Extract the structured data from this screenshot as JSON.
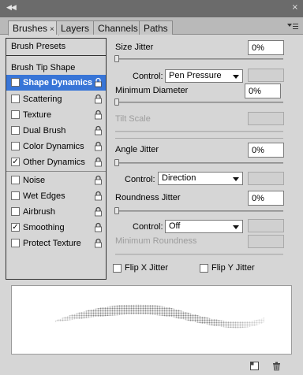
{
  "window": {
    "collapse_glyph": "◀◀",
    "close_glyph": "×"
  },
  "tabs": [
    {
      "label": "Brushes",
      "close": "×",
      "active": true
    },
    {
      "label": "Layers",
      "active": false
    },
    {
      "label": "Channels",
      "active": false
    },
    {
      "label": "Paths",
      "active": false
    }
  ],
  "left": {
    "presets_label": "Brush Presets",
    "tip_label": "Brush Tip Shape",
    "options": [
      {
        "label": "Shape Dynamics",
        "checked": true,
        "selected": true
      },
      {
        "label": "Scattering",
        "checked": false
      },
      {
        "label": "Texture",
        "checked": false
      },
      {
        "label": "Dual Brush",
        "checked": false
      },
      {
        "label": "Color Dynamics",
        "checked": false
      },
      {
        "label": "Other Dynamics",
        "checked": true
      },
      {
        "label": "Noise",
        "checked": false
      },
      {
        "label": "Wet Edges",
        "checked": false
      },
      {
        "label": "Airbrush",
        "checked": false
      },
      {
        "label": "Smoothing",
        "checked": true
      },
      {
        "label": "Protect Texture",
        "checked": false
      }
    ]
  },
  "right": {
    "size_jitter": {
      "label": "Size Jitter",
      "value": "0%"
    },
    "size_control": {
      "label": "Control:",
      "value": "Pen Pressure"
    },
    "min_diameter": {
      "label": "Minimum Diameter",
      "value": "0%"
    },
    "tilt_scale": {
      "label": "Tilt Scale"
    },
    "angle_jitter": {
      "label": "Angle Jitter",
      "value": "0%"
    },
    "angle_control": {
      "label": "Control:",
      "value": "Direction"
    },
    "roundness_jitter": {
      "label": "Roundness Jitter",
      "value": "0%"
    },
    "roundness_control": {
      "label": "Control:",
      "value": "Off"
    },
    "min_roundness": {
      "label": "Minimum Roundness"
    },
    "flip_x": {
      "label": "Flip X Jitter",
      "checked": false
    },
    "flip_y": {
      "label": "Flip Y Jitter",
      "checked": false
    }
  },
  "bottom": {
    "icons": [
      "new-preset-icon",
      "trash-icon"
    ]
  }
}
